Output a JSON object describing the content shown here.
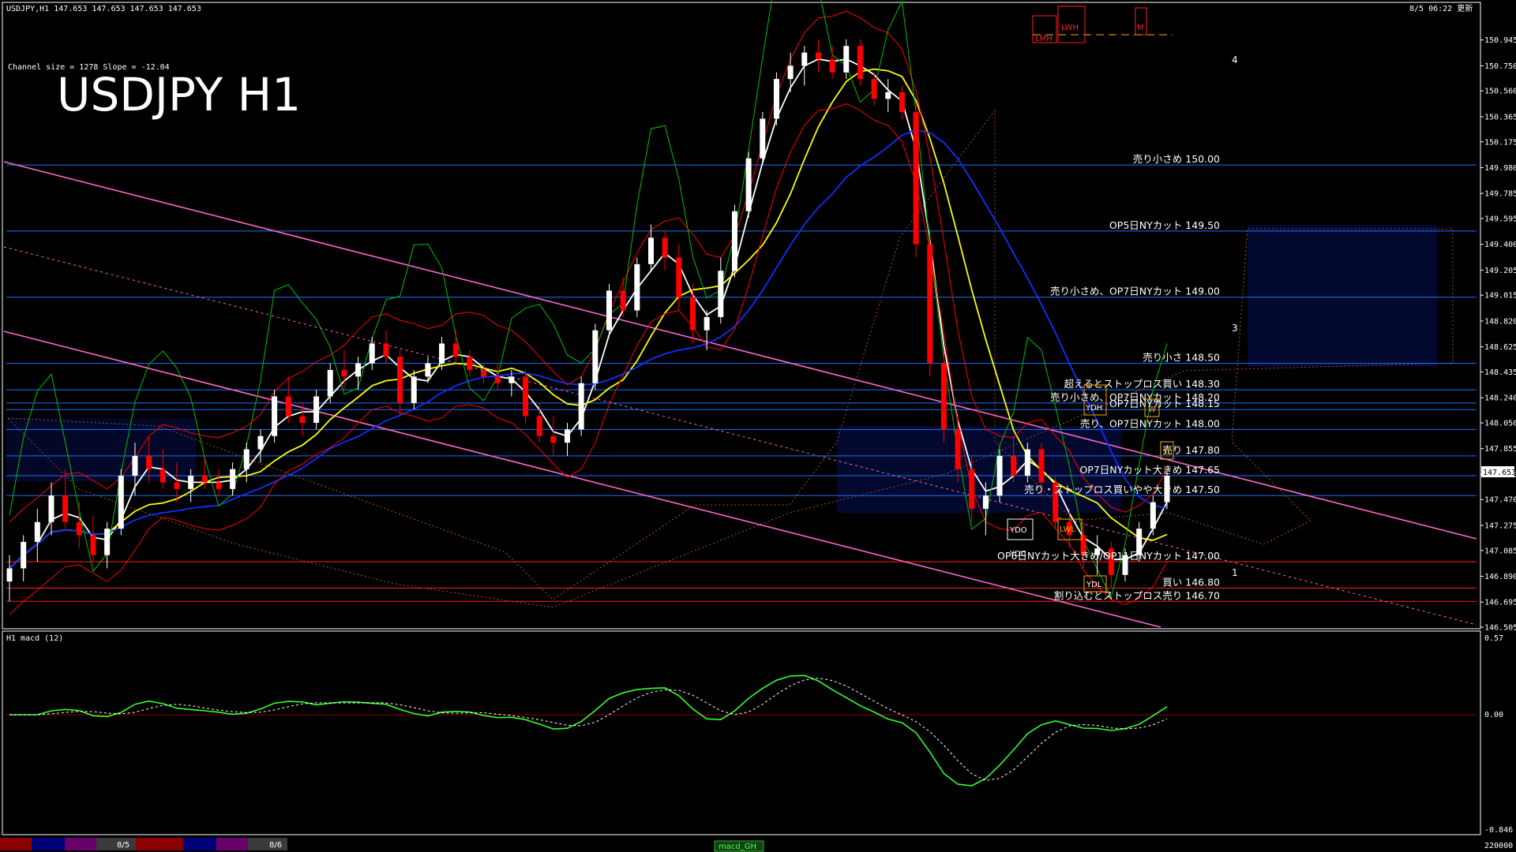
{
  "window": {
    "symbol_info": "USDJPY,H1  147.653 147.653 147.653 147.653",
    "timestamp": "8/5 06:22 更新",
    "channel_info": "Channel size = 1278 Slope = -12.04",
    "big_title": "USDJPY H1",
    "current_price": "147.653"
  },
  "macd": {
    "label": "H1  macd (12)",
    "ticks": [
      "0.57",
      "0.00",
      "-0.846"
    ],
    "tab_label": "macd_GH"
  },
  "time_axis": {
    "labels": [
      "8/5",
      "8/6"
    ],
    "volume_label": "220000"
  },
  "legend_boxes": [
    "LMH",
    "LWH",
    "M"
  ],
  "wave_labels": [
    "4",
    "3",
    "1"
  ],
  "box_labels": [
    "YDH",
    "YDO",
    "YDC",
    "YDL",
    "LWL",
    "W",
    "D"
  ],
  "colors": {
    "bg": "#000000",
    "up": "#ffffff",
    "down": "#ff0000",
    "level": "#1e6fff",
    "level_red": "#ff2020",
    "trend": "#ff66cc",
    "sma_white": "#ffffff",
    "sma_yellow": "#ffff00",
    "sma_blue": "#1030ff",
    "green": "#00c000",
    "macd_pos": "#33ff33",
    "macd_neg": "#ff66aa"
  },
  "chart_data": {
    "type": "candlestick",
    "title": "USDJPY H1",
    "y_ticks": [
      "150.945",
      "150.750",
      "150.560",
      "150.365",
      "150.175",
      "149.980",
      "149.785",
      "149.595",
      "149.400",
      "149.205",
      "149.015",
      "148.820",
      "148.625",
      "148.435",
      "148.240",
      "148.050",
      "147.855",
      "147.660",
      "147.470",
      "147.275",
      "147.085",
      "146.890",
      "146.695",
      "146.505"
    ],
    "ylim": [
      146.505,
      151.14
    ],
    "levels": [
      {
        "label": "売り小さめ 150.00",
        "price": 150.0
      },
      {
        "label": "OP5日NYカット 149.50",
        "price": 149.5
      },
      {
        "label": "売り小さめ、OP7日NYカット 149.00",
        "price": 149.0
      },
      {
        "label": "売り小さ 148.50",
        "price": 148.5
      },
      {
        "label": "超えるとストップロス買い 148.30",
        "price": 148.3
      },
      {
        "label": "売り小さめ、OP7日NYカット 148.20",
        "price": 148.2
      },
      {
        "label": "OP7日NYカット 148.15",
        "price": 148.15
      },
      {
        "label": "売り、OP7日NYカット 148.00",
        "price": 148.0
      },
      {
        "label": "売り 147.80",
        "price": 147.8
      },
      {
        "label": "OP7日NYカット大きめ 147.65",
        "price": 147.65
      },
      {
        "label": "売り・ストップロス買いやや大きめ 147.50",
        "price": 147.5
      },
      {
        "label": "OP6日NYカット大きめ/OP11日NYカット 147.00",
        "price": 147.0
      },
      {
        "label": "買い 146.80",
        "price": 146.8
      },
      {
        "label": "割り込むとストップロス売り 146.70",
        "price": 146.7
      }
    ],
    "candles": [
      [
        146.85,
        147.05,
        146.7,
        146.95
      ],
      [
        146.95,
        147.2,
        146.85,
        147.15
      ],
      [
        147.15,
        147.4,
        147.0,
        147.3
      ],
      [
        147.3,
        147.6,
        147.2,
        147.5
      ],
      [
        147.5,
        147.7,
        147.25,
        147.3
      ],
      [
        147.3,
        147.45,
        147.1,
        147.2
      ],
      [
        147.2,
        147.35,
        147.0,
        147.05
      ],
      [
        147.05,
        147.3,
        146.95,
        147.25
      ],
      [
        147.25,
        147.7,
        147.2,
        147.65
      ],
      [
        147.65,
        147.9,
        147.5,
        147.8
      ],
      [
        147.8,
        147.95,
        147.6,
        147.7
      ],
      [
        147.7,
        147.85,
        147.55,
        147.6
      ],
      [
        147.6,
        147.75,
        147.45,
        147.55
      ],
      [
        147.55,
        147.7,
        147.45,
        147.65
      ],
      [
        147.65,
        147.8,
        147.55,
        147.6
      ],
      [
        147.6,
        147.7,
        147.5,
        147.55
      ],
      [
        147.55,
        147.75,
        147.5,
        147.7
      ],
      [
        147.7,
        147.9,
        147.6,
        147.85
      ],
      [
        147.85,
        148.0,
        147.75,
        147.95
      ],
      [
        147.95,
        148.3,
        147.9,
        148.25
      ],
      [
        148.25,
        148.4,
        148.05,
        148.1
      ],
      [
        148.1,
        148.2,
        147.95,
        148.05
      ],
      [
        148.05,
        148.3,
        148.0,
        148.25
      ],
      [
        148.25,
        148.5,
        148.2,
        148.45
      ],
      [
        148.45,
        148.6,
        148.3,
        148.4
      ],
      [
        148.4,
        148.55,
        148.3,
        148.5
      ],
      [
        148.5,
        148.7,
        148.45,
        148.65
      ],
      [
        148.65,
        148.75,
        148.5,
        148.55
      ],
      [
        148.55,
        148.6,
        148.1,
        148.2
      ],
      [
        148.2,
        148.45,
        148.15,
        148.4
      ],
      [
        148.4,
        148.55,
        148.35,
        148.5
      ],
      [
        148.5,
        148.7,
        148.45,
        148.65
      ],
      [
        148.65,
        148.75,
        148.5,
        148.55
      ],
      [
        148.55,
        148.6,
        148.4,
        148.45
      ],
      [
        148.45,
        148.5,
        148.35,
        148.4
      ],
      [
        148.4,
        148.5,
        148.3,
        148.35
      ],
      [
        148.35,
        148.45,
        148.25,
        148.4
      ],
      [
        148.4,
        148.45,
        148.05,
        148.1
      ],
      [
        148.1,
        148.2,
        147.9,
        147.95
      ],
      [
        147.95,
        148.1,
        147.8,
        147.9
      ],
      [
        147.9,
        148.05,
        147.8,
        148.0
      ],
      [
        148.0,
        148.4,
        147.95,
        148.35
      ],
      [
        148.35,
        148.8,
        148.3,
        148.75
      ],
      [
        148.75,
        149.1,
        148.7,
        149.05
      ],
      [
        149.05,
        149.15,
        148.85,
        148.9
      ],
      [
        148.9,
        149.3,
        148.85,
        149.25
      ],
      [
        149.25,
        149.55,
        149.2,
        149.45
      ],
      [
        149.45,
        149.5,
        149.2,
        149.3
      ],
      [
        149.3,
        149.4,
        148.9,
        149.0
      ],
      [
        149.0,
        149.1,
        148.65,
        148.75
      ],
      [
        148.75,
        148.9,
        148.6,
        148.85
      ],
      [
        148.85,
        149.3,
        148.8,
        149.2
      ],
      [
        149.2,
        149.7,
        149.15,
        149.65
      ],
      [
        149.65,
        150.1,
        149.6,
        150.05
      ],
      [
        150.05,
        150.4,
        150.0,
        150.35
      ],
      [
        150.35,
        150.7,
        150.3,
        150.65
      ],
      [
        150.65,
        150.85,
        150.55,
        150.75
      ],
      [
        150.75,
        150.9,
        150.6,
        150.85
      ],
      [
        150.85,
        150.95,
        150.7,
        150.8
      ],
      [
        150.8,
        150.9,
        150.65,
        150.7
      ],
      [
        150.7,
        150.95,
        150.65,
        150.9
      ],
      [
        150.9,
        150.95,
        150.6,
        150.65
      ],
      [
        150.65,
        150.7,
        150.45,
        150.5
      ],
      [
        150.5,
        150.65,
        150.4,
        150.55
      ],
      [
        150.55,
        150.6,
        150.35,
        150.4
      ],
      [
        150.4,
        150.45,
        149.3,
        149.4
      ],
      [
        149.4,
        149.5,
        148.4,
        148.5
      ],
      [
        148.5,
        148.6,
        147.9,
        148.0
      ],
      [
        148.0,
        148.1,
        147.6,
        147.7
      ],
      [
        147.7,
        147.8,
        147.3,
        147.4
      ],
      [
        147.4,
        147.6,
        147.2,
        147.5
      ],
      [
        147.5,
        147.85,
        147.45,
        147.8
      ],
      [
        147.8,
        147.95,
        147.6,
        147.65
      ],
      [
        147.65,
        147.9,
        147.6,
        147.85
      ],
      [
        147.85,
        147.9,
        147.5,
        147.6
      ],
      [
        147.6,
        147.65,
        147.25,
        147.3
      ],
      [
        147.3,
        147.4,
        147.1,
        147.2
      ],
      [
        147.2,
        147.3,
        146.95,
        147.05
      ],
      [
        147.05,
        147.2,
        146.9,
        147.1
      ],
      [
        147.1,
        147.15,
        146.8,
        146.9
      ],
      [
        146.9,
        147.1,
        146.85,
        147.05
      ],
      [
        147.05,
        147.3,
        147.0,
        147.25
      ],
      [
        147.25,
        147.5,
        147.2,
        147.45
      ],
      [
        147.45,
        147.7,
        147.4,
        147.65
      ]
    ]
  }
}
